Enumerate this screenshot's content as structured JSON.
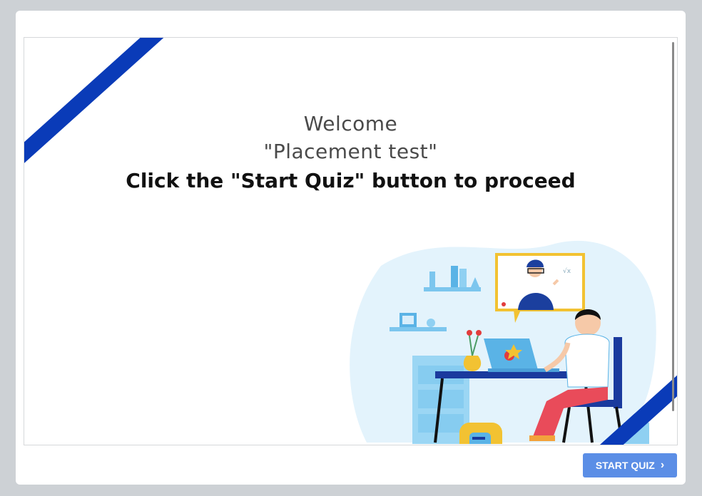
{
  "slide": {
    "line1": "Welcome",
    "line2": "\"Placement test\"",
    "line3": "Click the \"Start Quiz\" button to proceed"
  },
  "footer": {
    "start_label": "START QUIZ",
    "start_icon": "chevron-right-icon"
  },
  "colors": {
    "accent_stripe": "#0a3bb8",
    "button": "#5b8ee6",
    "frame": "#cdd1d5"
  }
}
